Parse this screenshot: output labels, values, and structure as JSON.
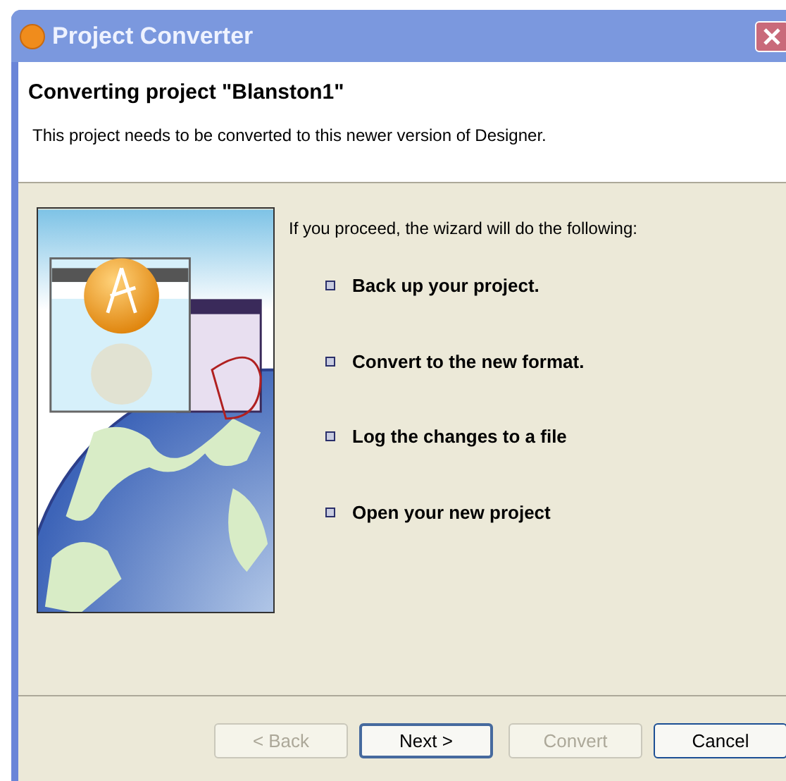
{
  "window": {
    "title": "Project Converter"
  },
  "header": {
    "title": "Converting project \"Blanston1\"",
    "description": "This project needs to be converted to this newer version of Designer."
  },
  "intro": "If you proceed, the wizard will do the following:",
  "steps": [
    "Back up your project.",
    "Convert to the new format.",
    "Log the changes to a file",
    "Open your new project"
  ],
  "buttons": [
    {
      "label": "< Back",
      "disabled": true,
      "default": false
    },
    {
      "label": "Next >",
      "disabled": false,
      "default": true
    },
    {
      "label": "Convert",
      "disabled": true,
      "default": false
    },
    {
      "label": "Cancel",
      "disabled": false,
      "default": false
    }
  ]
}
